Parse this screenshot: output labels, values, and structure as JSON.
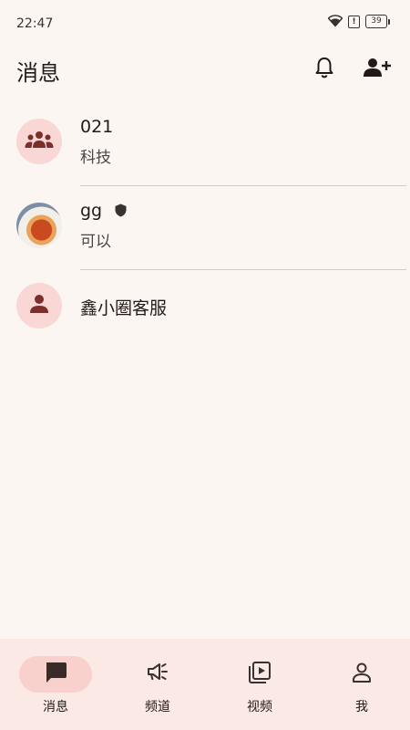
{
  "status": {
    "time": "22:47",
    "battery": "39"
  },
  "header": {
    "title": "消息"
  },
  "conversations": [
    {
      "name": "021",
      "subtitle": "科技"
    },
    {
      "name": "gg",
      "subtitle": "可以"
    },
    {
      "name": "鑫小圈客服",
      "subtitle": ""
    }
  ],
  "nav": [
    {
      "label": "消息",
      "icon": "chat-icon",
      "active": true
    },
    {
      "label": "频道",
      "icon": "megaphone-icon",
      "active": false
    },
    {
      "label": "视频",
      "icon": "video-library-icon",
      "active": false
    },
    {
      "label": "我",
      "icon": "person-icon",
      "active": false
    }
  ],
  "colors": {
    "background": "#fcf6f3",
    "accent": "#f8d1cd",
    "icon": "#7a2f2b",
    "navBar": "#fbe9e6"
  }
}
